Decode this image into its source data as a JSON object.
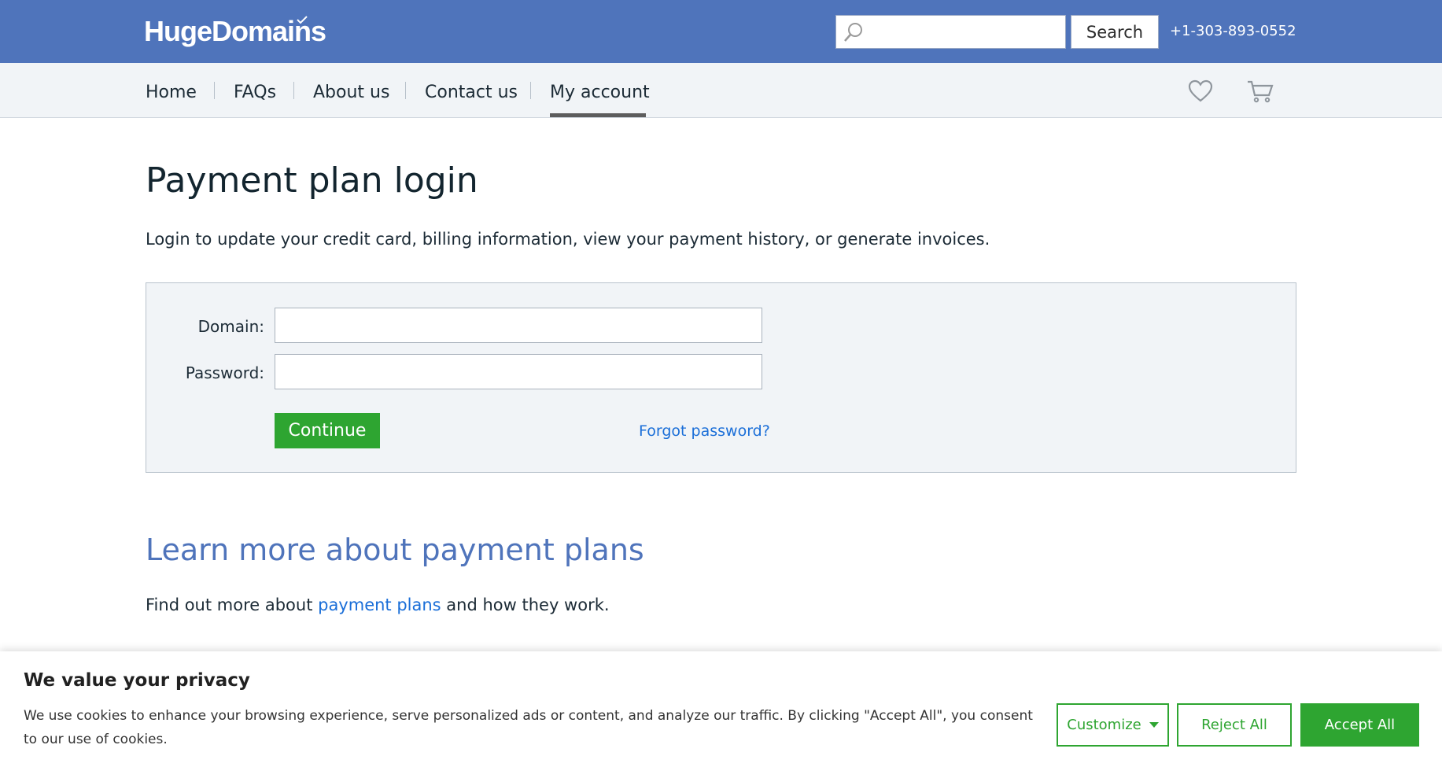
{
  "header": {
    "logo": "HugeDomains",
    "search": {
      "placeholder": "",
      "value": "",
      "button_label": "Search"
    },
    "phone": "+1-303-893-0552",
    "bg_color": "#4f74bb"
  },
  "nav": {
    "items": [
      {
        "label": "Home"
      },
      {
        "label": "FAQs"
      },
      {
        "label": "About us"
      },
      {
        "label": "Contact us"
      },
      {
        "label": "My account",
        "active": true
      }
    ],
    "icons": [
      "heart-icon",
      "cart-icon"
    ]
  },
  "main": {
    "title": "Payment plan login",
    "intro": "Login to update your credit card, billing information, view your payment history, or generate invoices.",
    "form": {
      "domain_label": "Domain:",
      "domain_value": "",
      "password_label": "Password:",
      "password_value": "",
      "continue_label": "Continue",
      "forgot_label": "Forgot password?"
    },
    "learn": {
      "heading": "Learn more about payment plans",
      "text_before": "Find out more about ",
      "link": "payment plans",
      "text_after": " and how they work."
    }
  },
  "cookie": {
    "title": "We value your privacy",
    "text": "We use cookies to enhance your browsing experience, serve personalized ads or content, and analyze our traffic. By clicking \"Accept All\", you consent to our use of cookies.",
    "customize_label": "Customize",
    "reject_label": "Reject All",
    "accept_label": "Accept All",
    "accent_color": "#2ea531"
  }
}
